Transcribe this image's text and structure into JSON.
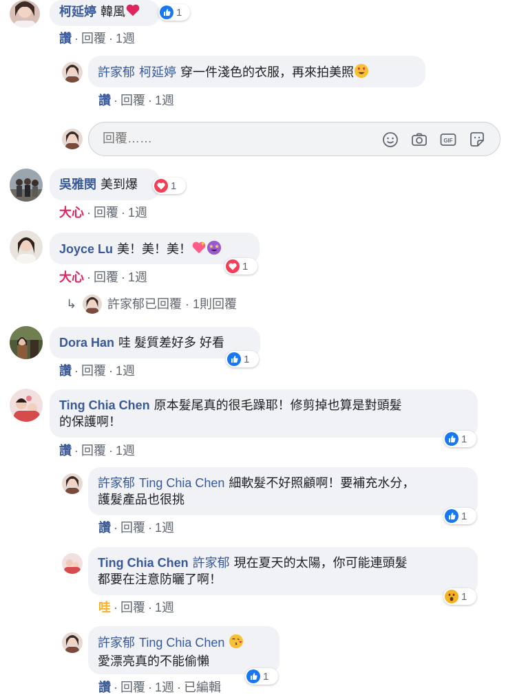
{
  "colors": {
    "link": "#385898",
    "love": "#e0245e",
    "wow": "#f7b125",
    "like": "#1877f2",
    "bubble": "#f0f2f5"
  },
  "comments": [
    {
      "author": "柯延婷",
      "text": "韓風",
      "emoji": "heart",
      "reaction": {
        "icon": "like-icon",
        "count": "1"
      },
      "actions": {
        "react": "讚",
        "reply": "回覆",
        "time": "1週"
      }
    },
    {
      "author": "許家郁",
      "mention": "柯延婷",
      "text": "穿一件淺色的衣服，再來拍美照",
      "emoji": "heart-eyes",
      "actions": {
        "react": "讚",
        "reply": "回覆",
        "time": "1週"
      }
    },
    {
      "author": "吳雅閔",
      "text": "美到爆",
      "reaction": {
        "icon": "love-icon",
        "count": "1"
      },
      "actions": {
        "react": "大心",
        "reply": "回覆",
        "time": "1週"
      }
    },
    {
      "author": "Joyce Lu",
      "text": "美！美！美！",
      "emoji": "sparkle-heart star-struck",
      "reaction": {
        "icon": "love-icon",
        "count": "1"
      },
      "actions": {
        "react": "大心",
        "reply": "回覆",
        "time": "1週"
      }
    },
    {
      "author": "Dora Han",
      "text": "哇 髮質差好多 好看",
      "reaction": {
        "icon": "like-icon",
        "count": "1"
      },
      "actions": {
        "react": "讚",
        "reply": "回覆",
        "time": "1週"
      }
    },
    {
      "author": "Ting Chia Chen",
      "text_line1": "原本髮尾真的很毛躁耶！修剪掉也算是對頭髮",
      "text_line2": "的保護啊！",
      "reaction": {
        "icon": "like-icon",
        "count": "1"
      },
      "actions": {
        "react": "讚",
        "reply": "回覆",
        "time": "1週"
      }
    },
    {
      "author": "許家郁",
      "mention": "Ting Chia Chen",
      "text_line1": "細軟髮不好照顧啊！要補充水分，",
      "text_line2": "護髮產品也很挑",
      "reaction": {
        "icon": "like-icon",
        "count": "1"
      },
      "actions": {
        "react": "讚",
        "reply": "回覆",
        "time": "1週"
      }
    },
    {
      "author": "Ting Chia Chen",
      "mention": "許家郁",
      "text_line1": "現在夏天的太陽，你可能連頭髮",
      "text_line2": "都要在注意防曬了啊！",
      "reaction": {
        "icon": "wow-icon",
        "count": "1"
      },
      "actions": {
        "react": "哇",
        "reply": "回覆",
        "time": "1週"
      }
    },
    {
      "author": "許家郁",
      "mention": "Ting Chia Chen",
      "emoji": "kissing-heart",
      "text_line2": "愛漂亮真的不能偷懶",
      "reaction": {
        "icon": "like-icon",
        "count": "1"
      },
      "actions": {
        "react": "讚",
        "reply": "回覆",
        "time": "1週",
        "edited": "已編輯"
      }
    }
  ],
  "reply_box": {
    "placeholder": "回覆……",
    "tools": [
      "smiley-icon",
      "camera-icon",
      "gif-icon",
      "sticker-icon"
    ]
  },
  "replies_summary": {
    "text": "許家郁已回覆 · 1則回覆"
  },
  "separator": "·"
}
